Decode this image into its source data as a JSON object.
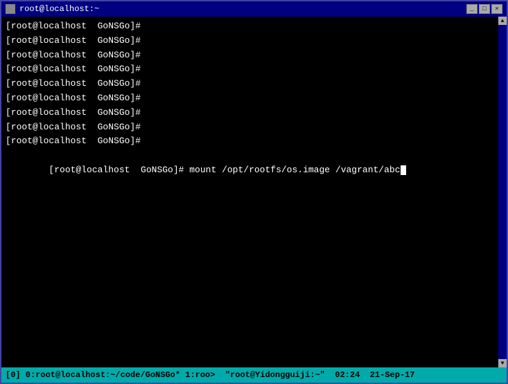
{
  "titleBar": {
    "title": "root@localhost:~",
    "minBtn": "_",
    "maxBtn": "□",
    "closeBtn": "×"
  },
  "terminal": {
    "lines": [
      "[root@localhost  GoNSGo]#",
      "[root@localhost  GoNSGo]#",
      "[root@localhost  GoNSGo]#",
      "[root@localhost  GoNSGo]#",
      "[root@localhost  GoNSGo]#",
      "[root@localhost  GoNSGo]#",
      "[root@localhost  GoNSGo]#",
      "[root@localhost  GoNSGo]#",
      "[root@localhost  GoNSGo]#",
      "[root@localhost  GoNSGo]# mount /opt/rootfs/os.image /vagrant/abc"
    ]
  },
  "statusBar": {
    "text": "[0] 0:root@localhost:~/code/GoNSGo* 1:roo>  \"root@Yidongguiji:~\"  02:24  21-Sep-17"
  }
}
